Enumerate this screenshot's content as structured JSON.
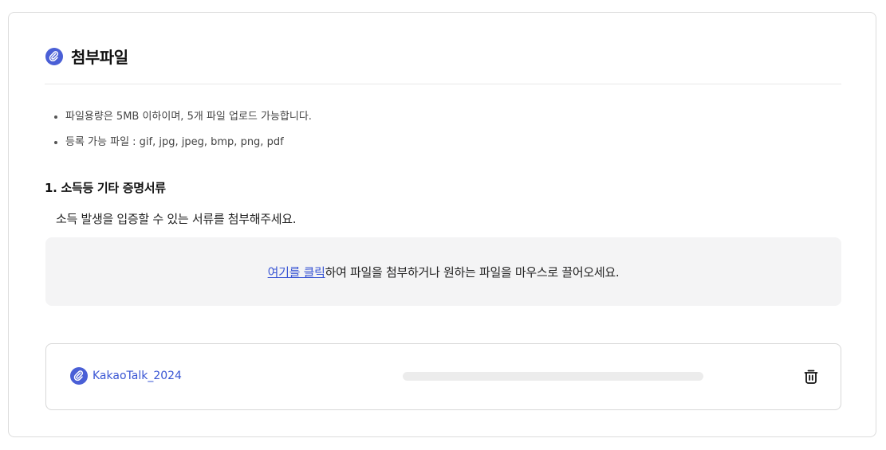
{
  "header": {
    "title": "첨부파일",
    "icon": "paperclip-icon",
    "accent_color": "#4a5fd6"
  },
  "notes": [
    "파일용량은 5MB 이하이며, 5개 파일 업로드 가능합니다.",
    "등록 가능 파일 : gif, jpg, jpeg, bmp, png, pdf"
  ],
  "section": {
    "title": "1. 소득등 기타 증명서류",
    "description": "소득 발생을 입증할 수 있는 서류를 첨부해주세요."
  },
  "dropzone": {
    "link_text": "여기를 클릭",
    "rest_text": "하여 파일을 첨부하거나 원하는 파일을 마우스로 끌어오세요."
  },
  "file": {
    "name": "KakaoTalk_2024",
    "icon": "paperclip-icon",
    "progress": 0,
    "delete_icon": "trash-icon"
  }
}
